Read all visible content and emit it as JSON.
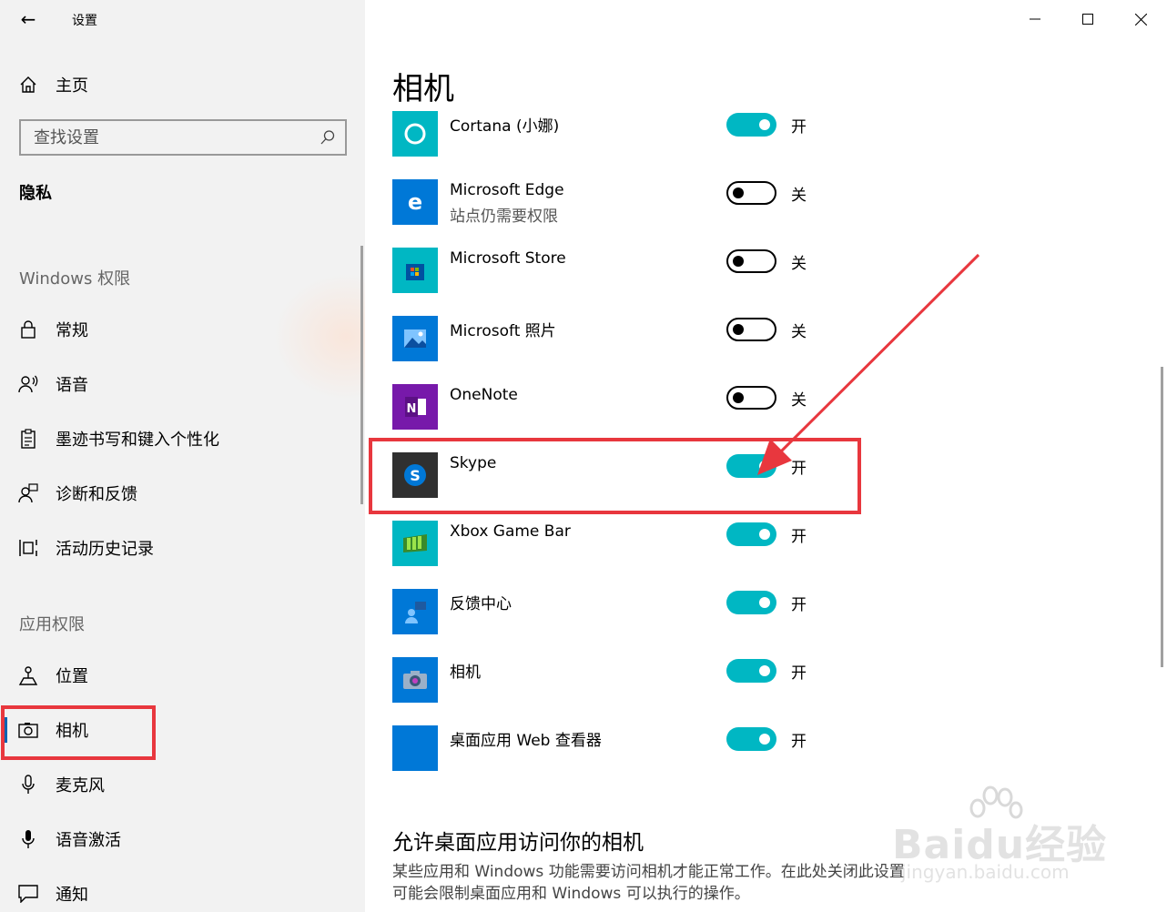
{
  "window": {
    "title": "设置",
    "back_icon": "←",
    "controls": [
      "minimize-icon",
      "maximize-icon",
      "close-icon"
    ]
  },
  "sidebar": {
    "home_label": "主页",
    "search_placeholder": "查找设置",
    "section": "隐私",
    "group_windows": "Windows 权限",
    "windows_items": [
      {
        "label": "常规",
        "icon": "lock-icon"
      },
      {
        "label": "语音",
        "icon": "speech-icon"
      },
      {
        "label": "墨迹书写和键入个性化",
        "icon": "clipboard-icon"
      },
      {
        "label": "诊断和反馈",
        "icon": "feedback-person-icon"
      },
      {
        "label": "活动历史记录",
        "icon": "timeline-icon"
      }
    ],
    "group_apps": "应用权限",
    "app_items": [
      {
        "label": "位置",
        "icon": "location-person-icon"
      },
      {
        "label": "相机",
        "icon": "camera-icon",
        "selected": true
      },
      {
        "label": "麦克风",
        "icon": "microphone-icon"
      },
      {
        "label": "语音激活",
        "icon": "voice-activation-icon"
      },
      {
        "label": "通知",
        "icon": "notification-icon"
      }
    ]
  },
  "main": {
    "title": "相机",
    "apps": [
      {
        "name": "Cortana (小娜)",
        "sub": "",
        "state": "开",
        "on": true,
        "tile": "#00b7c3",
        "icon": "cortana-icon"
      },
      {
        "name": "Microsoft Edge",
        "sub": "站点仍需要权限",
        "state": "关",
        "on": false,
        "tile": "#0078d7",
        "icon": "edge-icon"
      },
      {
        "name": "Microsoft Store",
        "sub": "",
        "state": "关",
        "on": false,
        "tile": "#00b7c3",
        "icon": "store-icon"
      },
      {
        "name": "Microsoft 照片",
        "sub": "",
        "state": "关",
        "on": false,
        "tile": "#0078d7",
        "icon": "photos-icon"
      },
      {
        "name": "OneNote",
        "sub": "",
        "state": "关",
        "on": false,
        "tile": "#7719aa",
        "icon": "onenote-icon"
      },
      {
        "name": "Skype",
        "sub": "",
        "state": "开",
        "on": true,
        "tile": "#303030",
        "icon": "skype-icon"
      },
      {
        "name": "Xbox Game Bar",
        "sub": "",
        "state": "开",
        "on": true,
        "tile": "#00b7c3",
        "icon": "xbox-game-bar-icon"
      },
      {
        "name": "反馈中心",
        "sub": "",
        "state": "开",
        "on": true,
        "tile": "#0078d7",
        "icon": "feedback-hub-icon"
      },
      {
        "name": "相机",
        "sub": "",
        "state": "开",
        "on": true,
        "tile": "#0078d7",
        "icon": "camera-app-icon"
      },
      {
        "name": "桌面应用 Web 查看器",
        "sub": "",
        "state": "开",
        "on": true,
        "tile": "#0078d7",
        "icon": "web-viewer-icon"
      }
    ],
    "desktop_heading": "允许桌面应用访问你的相机",
    "desktop_desc": "某些应用和 Windows 功能需要访问相机才能正常工作。在此处关闭此设置可能会限制桌面应用和 Windows 可以执行的操作。"
  },
  "watermark": {
    "text": "Baidu经验",
    "sub": "jingyan.baidu.com"
  },
  "colors": {
    "accent": "#00b7c3",
    "highlight": "#e8373e",
    "sidebar_bg": "#f2f2f2"
  }
}
